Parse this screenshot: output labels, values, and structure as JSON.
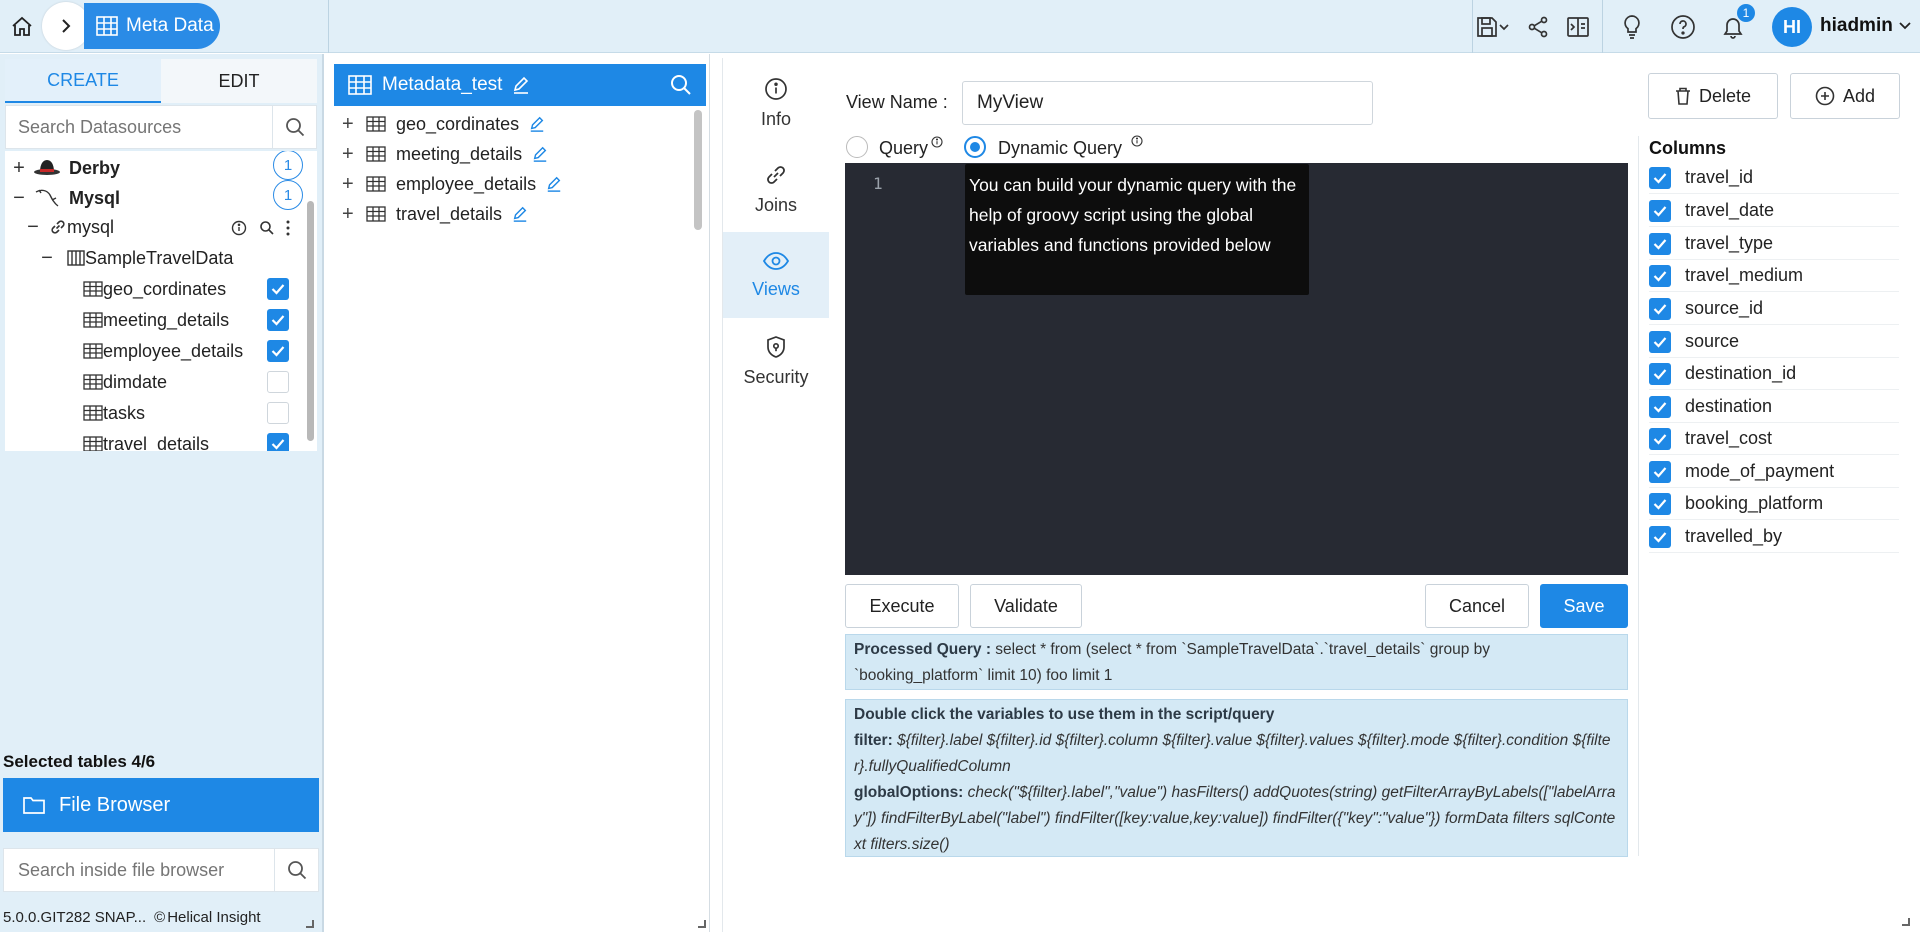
{
  "header": {
    "breadcrumb_label": "Meta Data",
    "notification_count": "1",
    "avatar_initials": "HI",
    "username": "hiadmin"
  },
  "left_panel": {
    "tabs": [
      {
        "label": "CREATE"
      },
      {
        "label": "EDIT"
      }
    ],
    "search_placeholder": "Search Datasources",
    "datasources": [
      {
        "name": "Derby",
        "count": "1"
      },
      {
        "name": "Mysql",
        "count": "1"
      }
    ],
    "connection": "mysql",
    "schema": "SampleTravelData",
    "tables": [
      {
        "name": "geo_cordinates",
        "checked": true
      },
      {
        "name": "meeting_details",
        "checked": true
      },
      {
        "name": "employee_details",
        "checked": true
      },
      {
        "name": "dimdate",
        "checked": false
      },
      {
        "name": "tasks",
        "checked": false
      },
      {
        "name": "travel_details",
        "checked": true
      }
    ],
    "selected_tables": "Selected tables 4/6",
    "file_browser_label": "File Browser",
    "file_search_placeholder": "Search inside file browser",
    "version": "5.0.0.GIT282 SNAP...",
    "copyright": "Helical Insight"
  },
  "metadata_panel": {
    "title": "Metadata_test",
    "tables": [
      {
        "name": "geo_cordinates"
      },
      {
        "name": "meeting_details"
      },
      {
        "name": "employee_details"
      },
      {
        "name": "travel_details"
      }
    ]
  },
  "side_nav": [
    {
      "label": "Info",
      "icon": "info-icon"
    },
    {
      "label": "Joins",
      "icon": "link-icon"
    },
    {
      "label": "Views",
      "icon": "eye-icon",
      "active": true
    },
    {
      "label": "Security",
      "icon": "shield-icon"
    }
  ],
  "view_editor": {
    "view_name_label": "View Name",
    "view_name_value": "MyView",
    "delete_label": "Delete",
    "add_label": "Add",
    "query_label": "Query",
    "dynamic_query_label": "Dynamic Query",
    "selected_mode": "Dynamic Query",
    "line_number": "1",
    "tooltip": "You can build your dynamic query with the help of groovy script using the global variables and functions provided below",
    "execute_label": "Execute",
    "validate_label": "Validate",
    "cancel_label": "Cancel",
    "save_label": "Save",
    "processed_query_label": "Processed Query :",
    "processed_query": "select * from (select * from `SampleTravelData`.`travel_details` group by `booking_platform` limit 10) foo limit 1",
    "variables_heading": "Double click the variables to use them in the script/query",
    "filter_label": "filter:",
    "filter_vars": "${filter}.label ${filter}.id ${filter}.column ${filter}.value ${filter}.values ${filter}.mode ${filter}.condition ${filter}.fullyQualifiedColumn",
    "global_options_label": "globalOptions:",
    "global_options": "check(\"${filter}.label\",\"value\") hasFilters() addQuotes(string) getFilterArrayByLabels([\"labelArray\"]) findFilterByLabel(\"label\") findFilter([key:value,key:value]) findFilter({\"key\":\"value\"}) formData filters sqlContext filters.size()"
  },
  "columns_panel": {
    "title": "Columns",
    "columns": [
      {
        "name": "travel_id",
        "checked": true
      },
      {
        "name": "travel_date",
        "checked": true
      },
      {
        "name": "travel_type",
        "checked": true
      },
      {
        "name": "travel_medium",
        "checked": true
      },
      {
        "name": "source_id",
        "checked": true
      },
      {
        "name": "source",
        "checked": true
      },
      {
        "name": "destination_id",
        "checked": true
      },
      {
        "name": "destination",
        "checked": true
      },
      {
        "name": "travel_cost",
        "checked": true
      },
      {
        "name": "mode_of_payment",
        "checked": true
      },
      {
        "name": "booking_platform",
        "checked": true
      },
      {
        "name": "travelled_by",
        "checked": true
      }
    ]
  },
  "colors": {
    "accent": "#1e88e5",
    "header_bg": "#e1eff8",
    "editor_bg": "#272a33",
    "info_bg": "#d4e9f5"
  }
}
